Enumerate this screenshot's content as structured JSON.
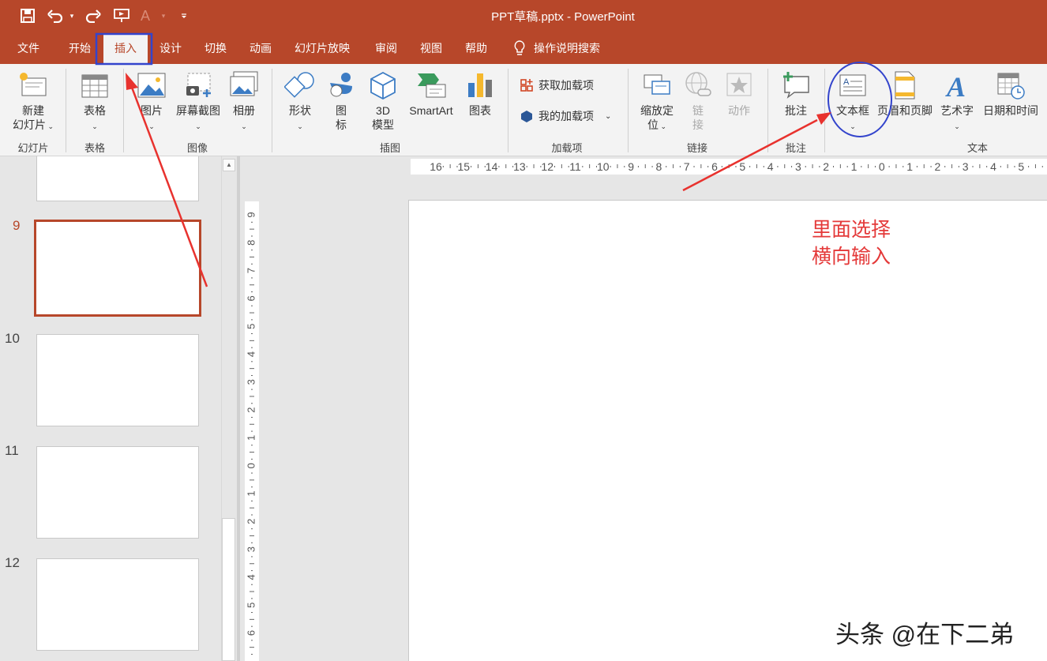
{
  "app": {
    "title": "PPT草稿.pptx  -  PowerPoint",
    "accent": "#b7472a"
  },
  "quick_access": {
    "save_icon": "save-icon",
    "undo_icon": "undo-icon",
    "redo_icon": "redo-icon",
    "present_icon": "present-from-beginning-icon",
    "font_icon": "font-icon",
    "font_glyph": "A",
    "customize_icon": "customize-qat-icon"
  },
  "tabs": [
    {
      "label": "文件"
    },
    {
      "label": "开始"
    },
    {
      "label": "插入"
    },
    {
      "label": "设计"
    },
    {
      "label": "切换"
    },
    {
      "label": "动画"
    },
    {
      "label": "幻灯片放映"
    },
    {
      "label": "审阅"
    },
    {
      "label": "视图"
    },
    {
      "label": "帮助"
    }
  ],
  "active_tab": "插入",
  "tell_me": "操作说明搜索",
  "ribbon": {
    "new_slide": {
      "line1": "新建",
      "line2": "幻灯片"
    },
    "table": "表格",
    "picture": "图片",
    "screenshot": "屏幕截图",
    "album": "相册",
    "shapes": "形状",
    "icons": {
      "line1": "图",
      "line2": "标"
    },
    "model3d": {
      "line1": "3D",
      "line2": "模型"
    },
    "smartart": "SmartArt",
    "chart": "图表",
    "get_addins": "获取加载项",
    "my_addins": "我的加载项",
    "zoom": {
      "line1": "缩放定",
      "line2": "位"
    },
    "link": {
      "line1": "链",
      "line2": "接"
    },
    "action": "动作",
    "comment": "批注",
    "textbox": "文本框",
    "header_footer": "页眉和页脚",
    "wordart": "艺术字",
    "datetime": "日期和时间",
    "groups": {
      "slides": "幻灯片",
      "tables": "表格",
      "images": "图像",
      "illustrations": "插图",
      "addins": "加载项",
      "links": "链接",
      "comments": "批注",
      "text": "文本"
    }
  },
  "slides": {
    "numbers": [
      "9",
      "10",
      "11",
      "12"
    ],
    "selected": "9"
  },
  "ruler": {
    "horizontal": [
      "16",
      "15",
      "14",
      "13",
      "12",
      "11",
      "10",
      "9",
      "8",
      "7",
      "6",
      "5",
      "4",
      "3",
      "2",
      "1",
      "0",
      "1",
      "2",
      "3",
      "4",
      "5"
    ],
    "vertical": [
      "9",
      "8",
      "7",
      "6",
      "5",
      "4",
      "3",
      "2",
      "1",
      "0",
      "1",
      "2",
      "3",
      "4",
      "5",
      "6"
    ]
  },
  "annotation": {
    "line1": "里面选择",
    "line2": "横向输入",
    "color": "#e43939"
  },
  "watermark": "头条 @在下二弟",
  "markers": {
    "arrow_color": "#e8322e",
    "tab_box_color": "#3344cc",
    "circle_color": "#3344cc"
  }
}
